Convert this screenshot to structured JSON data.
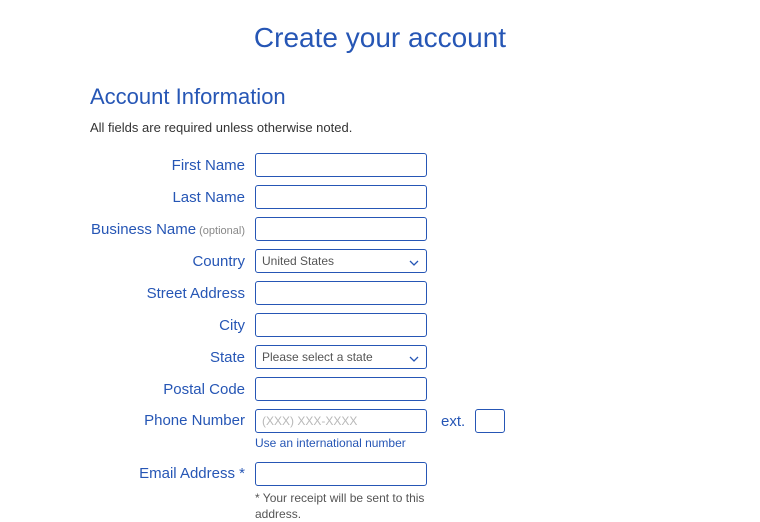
{
  "title": "Create your account",
  "section_heading": "Account Information",
  "required_note": "All fields are required unless otherwise noted.",
  "labels": {
    "first_name": "First Name",
    "last_name": "Last Name",
    "business_name": "Business Name",
    "business_optional": " (optional)",
    "country": "Country",
    "street_address": "Street Address",
    "city": "City",
    "state": "State",
    "postal_code": "Postal Code",
    "phone_number": "Phone Number",
    "ext": "ext.",
    "email_address": "Email Address *"
  },
  "values": {
    "first_name": "",
    "last_name": "",
    "business_name": "",
    "country": "United States",
    "street_address": "",
    "city": "",
    "state": "Please select a state",
    "postal_code": "",
    "phone_number": "",
    "phone_placeholder": "(XXX) XXX-XXXX",
    "ext": "",
    "email_address": ""
  },
  "links": {
    "intl_phone": "Use an international number"
  },
  "footnotes": {
    "email": "* Your receipt will be sent to this address."
  },
  "options": {
    "countries": [
      "United States"
    ],
    "states": [
      "Please select a state"
    ]
  }
}
